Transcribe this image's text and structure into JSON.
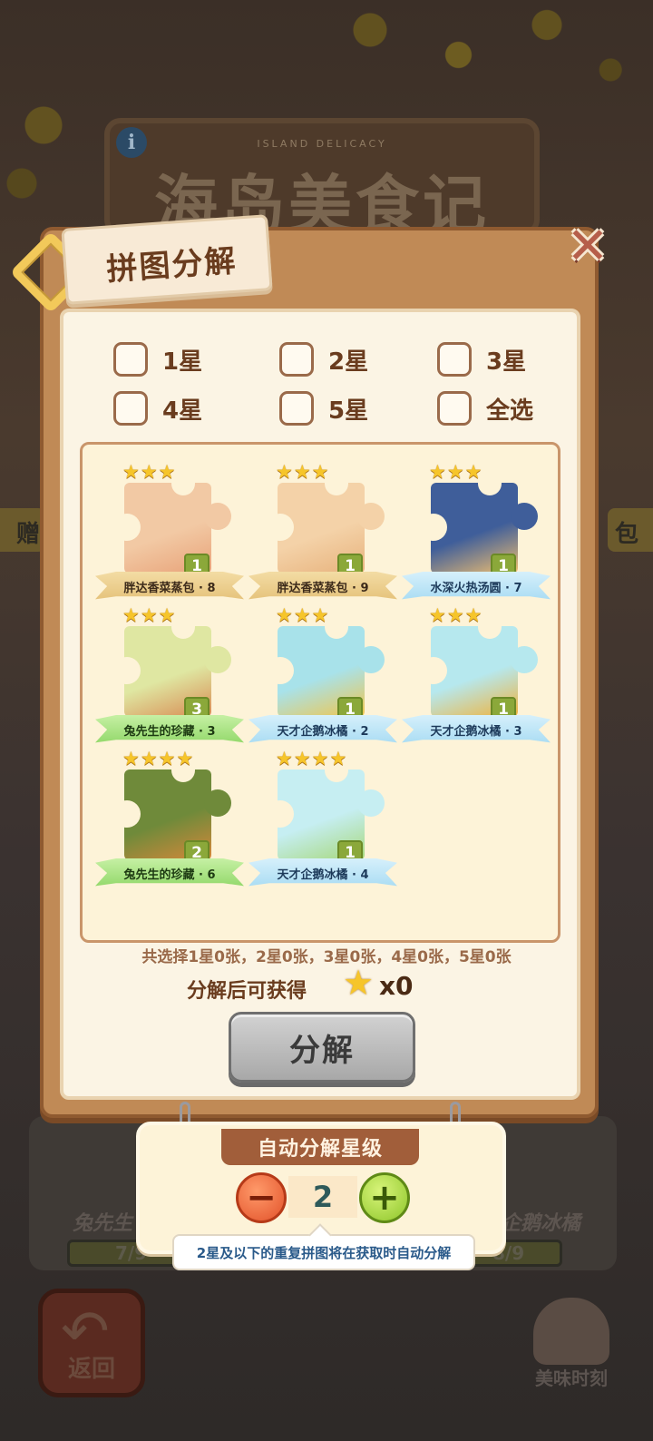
{
  "background": {
    "game_title": "海岛美食记",
    "game_subtitle": "ISLAND DELICACY",
    "info_icon": "i",
    "side_left": "赠",
    "side_right": "包",
    "card_left_name": "兔先生",
    "card_right_name": "企鹅冰橘",
    "progress_left": "7/9",
    "progress_right": "8/9",
    "back_label": "返回",
    "moment_label": "美味时刻"
  },
  "dialog": {
    "title": "拼图分解",
    "close_icon": "close-icon",
    "filters": [
      {
        "label": "1星",
        "checked": false
      },
      {
        "label": "2星",
        "checked": false
      },
      {
        "label": "3星",
        "checked": false
      },
      {
        "label": "4星",
        "checked": false
      },
      {
        "label": "5星",
        "checked": false
      },
      {
        "label": "全选",
        "checked": false
      }
    ],
    "pieces": [
      {
        "name": "胖达香菜蒸包 · 8",
        "stars": "★★★",
        "count": "1",
        "ribbon": "gold",
        "art": [
          "#f2c9a4",
          "#e8a278"
        ]
      },
      {
        "name": "胖达香菜蒸包 · 9",
        "stars": "★★★",
        "count": "1",
        "ribbon": "gold",
        "art": [
          "#f4d2a8",
          "#e7b27c"
        ]
      },
      {
        "name": "水深火热汤圆 · 7",
        "stars": "★★★",
        "count": "1",
        "ribbon": "blue",
        "art": [
          "#3f5e9a",
          "#f2c070"
        ]
      },
      {
        "name": "兔先生的珍藏 · 3",
        "stars": "★★★",
        "count": "3",
        "ribbon": "green",
        "art": [
          "#dfe7a2",
          "#d88a52"
        ]
      },
      {
        "name": "天才企鹅冰橘 · 2",
        "stars": "★★★",
        "count": "1",
        "ribbon": "blue",
        "art": [
          "#a8e2ea",
          "#f1c54a"
        ]
      },
      {
        "name": "天才企鹅冰橘 · 3",
        "stars": "★★★",
        "count": "1",
        "ribbon": "blue",
        "art": [
          "#b6e8ee",
          "#f0b23a"
        ]
      },
      {
        "name": "兔先生的珍藏 · 6",
        "stars": "★★★★",
        "count": "2",
        "ribbon": "green",
        "art": [
          "#6f8a3a",
          "#d7883a"
        ]
      },
      {
        "name": "天才企鹅冰橘 · 4",
        "stars": "★★★★",
        "count": "1",
        "ribbon": "blue",
        "art": [
          "#c6eef2",
          "#a6d87a"
        ]
      }
    ],
    "summary": "共选择1星0张，2星0张，3星0张，4星0张，5星0张",
    "reward_label": "分解后可获得",
    "reward_count": "x0",
    "decompose_button": "分解"
  },
  "auto_decompose": {
    "title": "自动分解星级",
    "level": "2",
    "minus": "−",
    "plus": "+",
    "tooltip": "2星及以下的重复拼图将在获取时自动分解"
  },
  "colors": {
    "dialog_wood": "#c08a56",
    "panel_cream": "#fbf4e4",
    "star_gold": "#f6c52a",
    "button_gray": "#bdbdbd",
    "minus_orange": "#e2522a",
    "plus_green": "#8ec62a"
  }
}
